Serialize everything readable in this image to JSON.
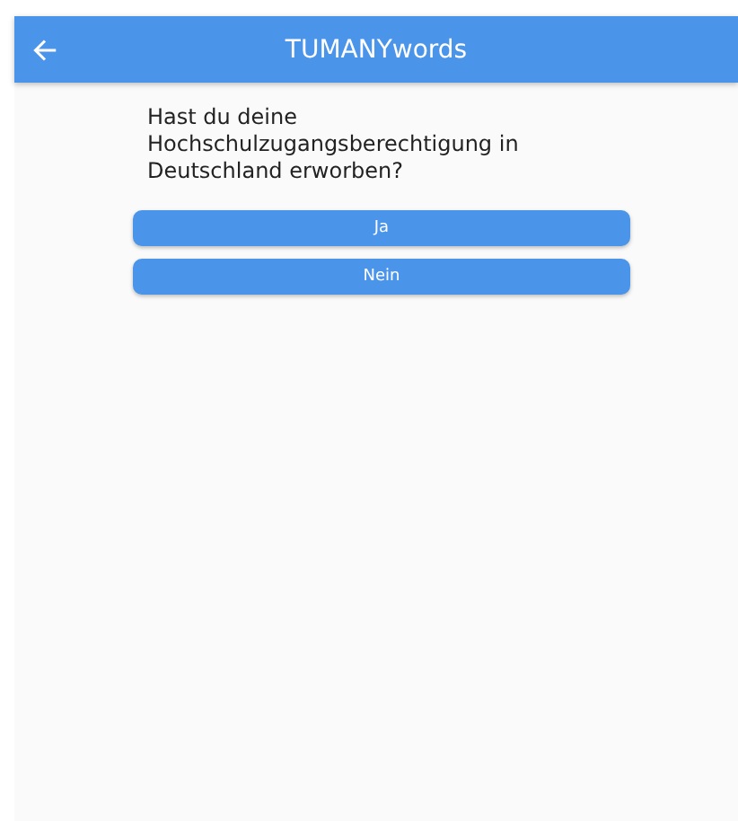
{
  "app_bar": {
    "title": "TUMANYwords"
  },
  "question": "Hast du deine Hochschulzugangsberechtigung in Deutschland erworben?",
  "buttons": [
    "Ja",
    "Nein"
  ]
}
